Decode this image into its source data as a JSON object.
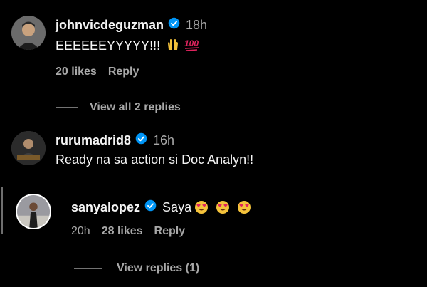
{
  "comments": [
    {
      "username": "johnvicdeguzman",
      "verified": true,
      "time": "18h",
      "text": "EEEEEEYYYYY!!!",
      "emojis": [
        "raised-hands-emoji",
        "hundred-points-emoji"
      ],
      "likes": "20 likes",
      "reply_label": "Reply",
      "view_replies": "View all 2 replies"
    },
    {
      "username": "rurumadrid8",
      "verified": true,
      "time": "16h",
      "text": "Ready na sa action si Doc Analyn!!"
    }
  ],
  "reply": {
    "username": "sanyalopez",
    "verified": true,
    "text": "Saya",
    "emojis": [
      "heart-eyes-emoji",
      "heart-eyes-emoji",
      "heart-eyes-emoji"
    ],
    "time": "20h",
    "likes": "28 likes",
    "reply_label": "Reply",
    "view_replies": "View replies (1)"
  },
  "colors": {
    "background": "#000000",
    "text": "#f5f5f5",
    "muted": "#a8a8a8",
    "verified": "#0095f6",
    "emoji_face": "#f5c33b",
    "emoji_heart": "#e0245e",
    "hundred_red": "#e0245e"
  }
}
